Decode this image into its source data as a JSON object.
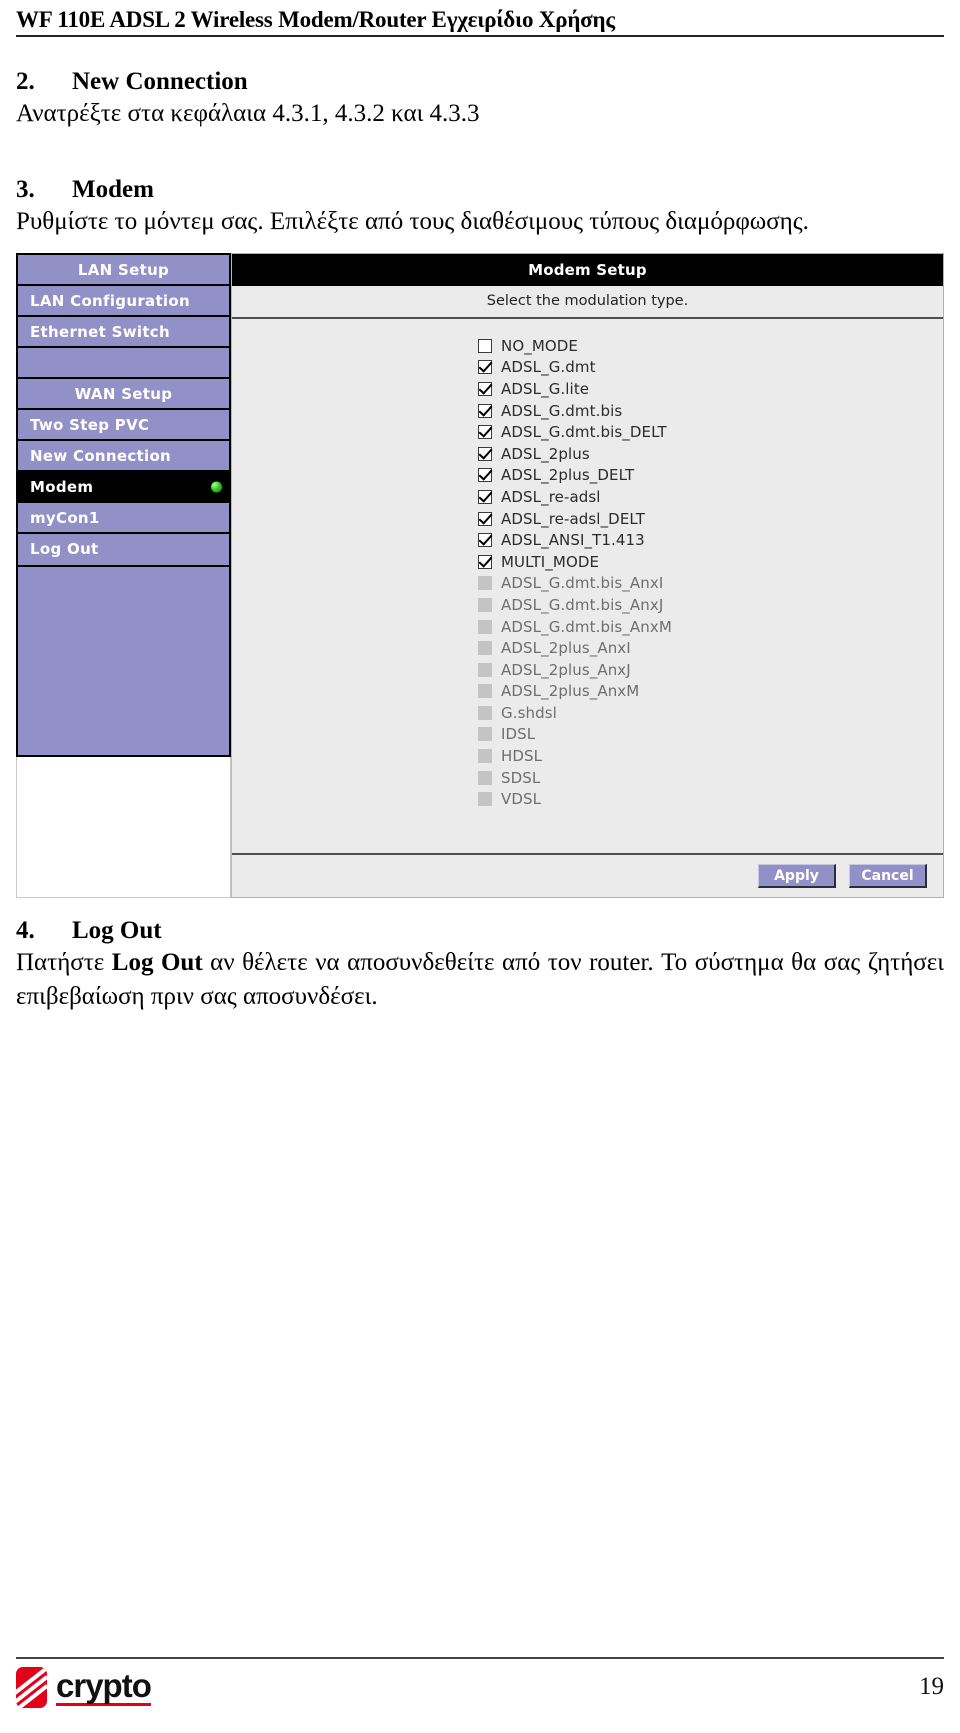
{
  "document": {
    "running_header": "WF 110E ADSL 2 Wireless Modem/Router Εγχειρίδιο Χρήσης",
    "page_number": "19",
    "brand_name": "crypto"
  },
  "sections": [
    {
      "number": "2.",
      "title": "New Connection",
      "body": "Ανατρέξτε στα κεφάλαια 4.3.1, 4.3.2 και 4.3.3"
    },
    {
      "number": "3.",
      "title": "Modem",
      "body": "Ρυθμίστε το μόντεμ σας. Επιλέξτε από τους διαθέσιμους τύπους διαμόρφωσης."
    },
    {
      "number": "4.",
      "title": "Log Out",
      "body_part1": "Πατήστε ",
      "body_bold": "Log Out",
      "body_part2": " αν θέλετε να αποσυνδεθείτε από τον router. Το σύστημα θα σας ζητήσει επιβεβαίωση πριν σας αποσυνδέσει."
    }
  ],
  "router_ui": {
    "panel_title": "Modem Setup",
    "panel_subtitle": "Select the modulation type.",
    "sidebar": [
      {
        "label": "LAN Setup",
        "type": "group",
        "active": false
      },
      {
        "label": "LAN Configuration",
        "type": "link",
        "active": false
      },
      {
        "label": "Ethernet Switch",
        "type": "link",
        "active": false
      },
      {
        "label": "",
        "type": "spacer",
        "active": false
      },
      {
        "label": "WAN Setup",
        "type": "group",
        "active": false
      },
      {
        "label": "Two Step PVC",
        "type": "link",
        "active": false
      },
      {
        "label": "New Connection",
        "type": "link",
        "active": false
      },
      {
        "label": "Modem",
        "type": "link",
        "active": true
      },
      {
        "label": "myCon1",
        "type": "link",
        "active": false
      },
      {
        "label": "Log Out",
        "type": "link",
        "active": false
      }
    ],
    "modulation_options": [
      {
        "label": "NO_MODE",
        "state": "unchecked"
      },
      {
        "label": "ADSL_G.dmt",
        "state": "checked"
      },
      {
        "label": "ADSL_G.lite",
        "state": "checked"
      },
      {
        "label": "ADSL_G.dmt.bis",
        "state": "checked"
      },
      {
        "label": "ADSL_G.dmt.bis_DELT",
        "state": "checked"
      },
      {
        "label": "ADSL_2plus",
        "state": "checked"
      },
      {
        "label": "ADSL_2plus_DELT",
        "state": "checked"
      },
      {
        "label": "ADSL_re-adsl",
        "state": "checked"
      },
      {
        "label": "ADSL_re-adsl_DELT",
        "state": "checked"
      },
      {
        "label": "ADSL_ANSI_T1.413",
        "state": "checked"
      },
      {
        "label": "MULTI_MODE",
        "state": "checked"
      },
      {
        "label": "ADSL_G.dmt.bis_AnxI",
        "state": "disabled"
      },
      {
        "label": "ADSL_G.dmt.bis_AnxJ",
        "state": "disabled"
      },
      {
        "label": "ADSL_G.dmt.bis_AnxM",
        "state": "disabled"
      },
      {
        "label": "ADSL_2plus_AnxI",
        "state": "disabled"
      },
      {
        "label": "ADSL_2plus_AnxJ",
        "state": "disabled"
      },
      {
        "label": "ADSL_2plus_AnxM",
        "state": "disabled"
      },
      {
        "label": "G.shdsl",
        "state": "disabled"
      },
      {
        "label": "IDSL",
        "state": "disabled"
      },
      {
        "label": "HDSL",
        "state": "disabled"
      },
      {
        "label": "SDSL",
        "state": "disabled"
      },
      {
        "label": "VDSL",
        "state": "disabled"
      }
    ],
    "buttons": {
      "apply": "Apply",
      "cancel": "Cancel"
    },
    "colors": {
      "sidebar": "#9191c8",
      "active_row": "#000000",
      "panel_bg": "#ebebeb",
      "led": "#37d120",
      "brand_red": "#e2001a"
    }
  }
}
